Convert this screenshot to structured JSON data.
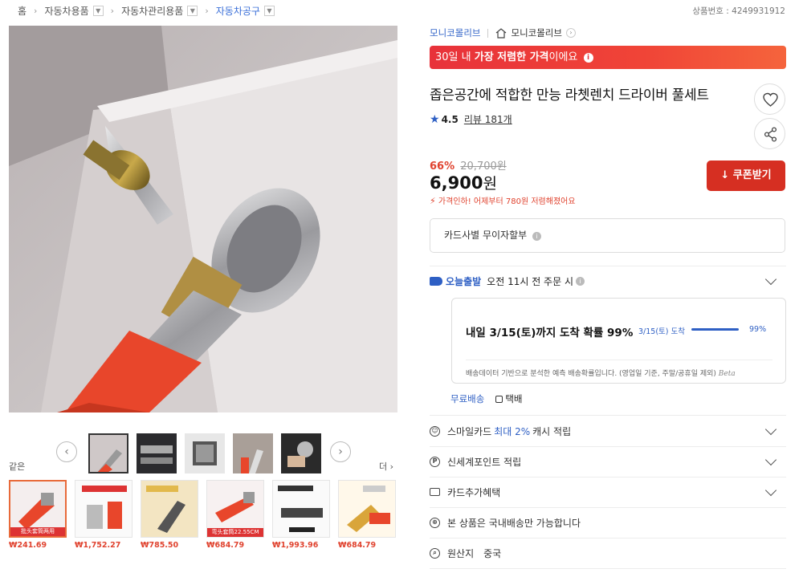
{
  "breadcrumb": {
    "home": "홈",
    "level1": "자동차용품",
    "level2": "자동차관리용품",
    "level3": "자동차공구"
  },
  "product_no": "상품번호 : 4249931912",
  "gallery": {
    "prev_arrow": "‹",
    "next_arrow": "›",
    "same_label": "같은",
    "more_label": "더 ›",
    "similar": [
      {
        "price": "₩241.69",
        "band": "批头套筒两用"
      },
      {
        "price": "₩1,752.27",
        "band": ""
      },
      {
        "price": "₩785.50",
        "band": ""
      },
      {
        "price": "₩684.79",
        "band": "弯头套筒22.55CM"
      },
      {
        "price": "₩1,993.96",
        "band": ""
      },
      {
        "price": "₩684.79",
        "band": ""
      }
    ]
  },
  "store": {
    "name": "모니코몰리브",
    "home_label": "모니코몰리브"
  },
  "banner": {
    "prefix": "30일 내 ",
    "bold": "가장 저렴한 가격",
    "suffix": "이에요",
    "info": "i"
  },
  "product": {
    "title": "좁은공간에 적합한 만능 라쳇렌치 드라이버 풀세트",
    "rating": "4.5",
    "reviews": "리뷰 181개",
    "discount": "66%",
    "original_price": "20,700원",
    "price": "6,900",
    "price_unit": "원",
    "drop_note": "가격인하! 어제부터 780원 저렴해졌어요"
  },
  "coupon_label": "↓ 쿠폰받기",
  "installment_label": "카드사별 무이자할부",
  "shipping": {
    "logo": "오늘출발",
    "cutoff": "오전 11시 전 주문 시",
    "arrival_main": "내일 3/15(토)까지 도착 확률 99%",
    "arrival_date": "3/15(토) 도착",
    "arrival_probability": 0.99,
    "arrival_pct": "99%",
    "note": "배송데이터 기반으로 분석한 예측 배송확률입니다. (영업일 기준, 주말/공휴일 제외)",
    "beta": "Beta",
    "free": "무료배송",
    "courier": "택배"
  },
  "benefits": {
    "smile_prefix": "스마일카드",
    "smile_blue": "최대 2%",
    "smile_suffix": "캐시 적립",
    "ssg": "신세계포인트 적립",
    "card": "카드추가혜택",
    "domestic": "본 상품은 국내배송만 가능합니다",
    "origin_label": "원산지",
    "origin_value": "중국"
  },
  "colors": {
    "accent_blue": "#2e5fc4",
    "sale_red": "#e0432f",
    "coupon_red": "#d62f22"
  }
}
